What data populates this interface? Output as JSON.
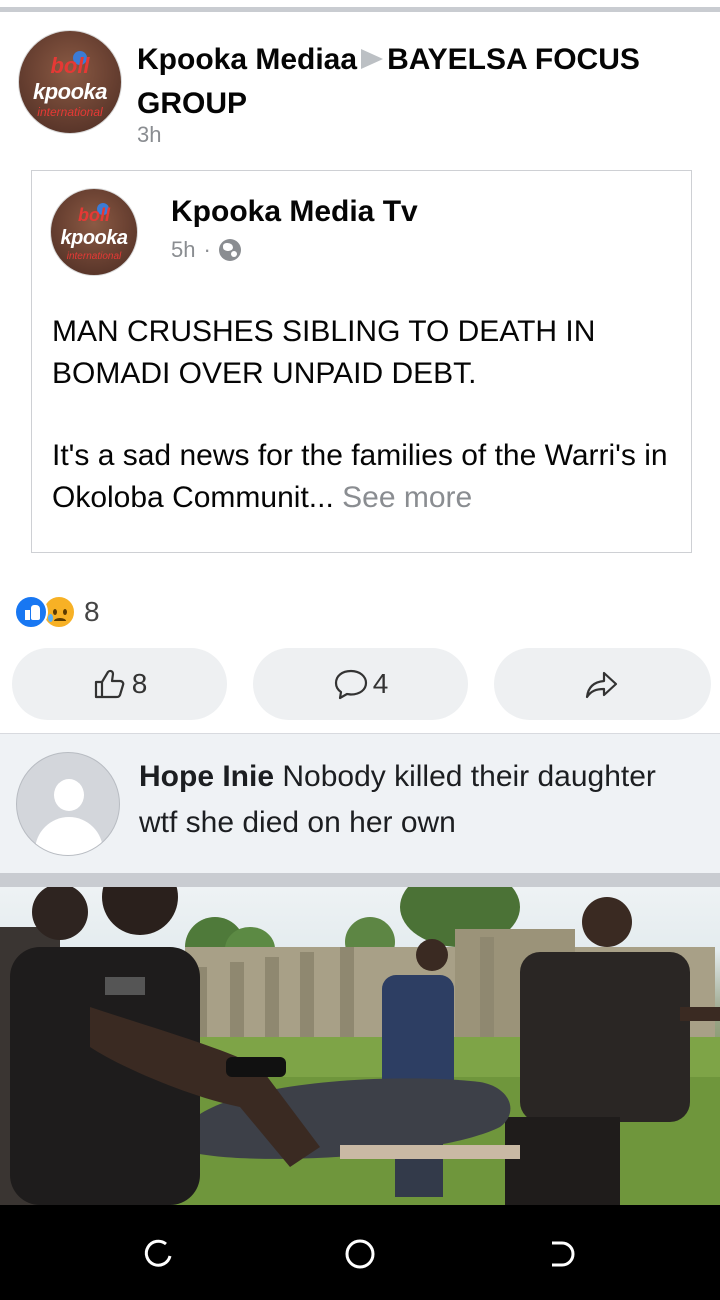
{
  "post": {
    "author": "Kpooka Mediaa",
    "group": "BAYELSA FOCUS GROUP",
    "time": "3h",
    "avatar_logo": {
      "top": "boll",
      "main": "kpooka",
      "sub": "international"
    }
  },
  "shared": {
    "author": "Kpooka Media Tv",
    "time": "5h",
    "separator": "·",
    "privacy_icon": "globe-icon",
    "headline": "MAN CRUSHES SIBLING TO DEATH IN BOMADI OVER UNPAID DEBT.",
    "body": "It's a sad news for the families of the Warri's in Okoloba Communit...",
    "see_more": "See more"
  },
  "reactions": {
    "types": [
      "like",
      "sad"
    ],
    "count": "8"
  },
  "actions": {
    "like_count": "8",
    "comment_count": "4",
    "share_label": ""
  },
  "comment": {
    "author": "Hope Inie",
    "text": "Nobody killed their daughter wtf she died on her own"
  },
  "colors": {
    "accent": "#1877f2",
    "muted": "#8a8d91",
    "button_bg": "#eef0f2",
    "comment_bg": "#eff2f5"
  }
}
